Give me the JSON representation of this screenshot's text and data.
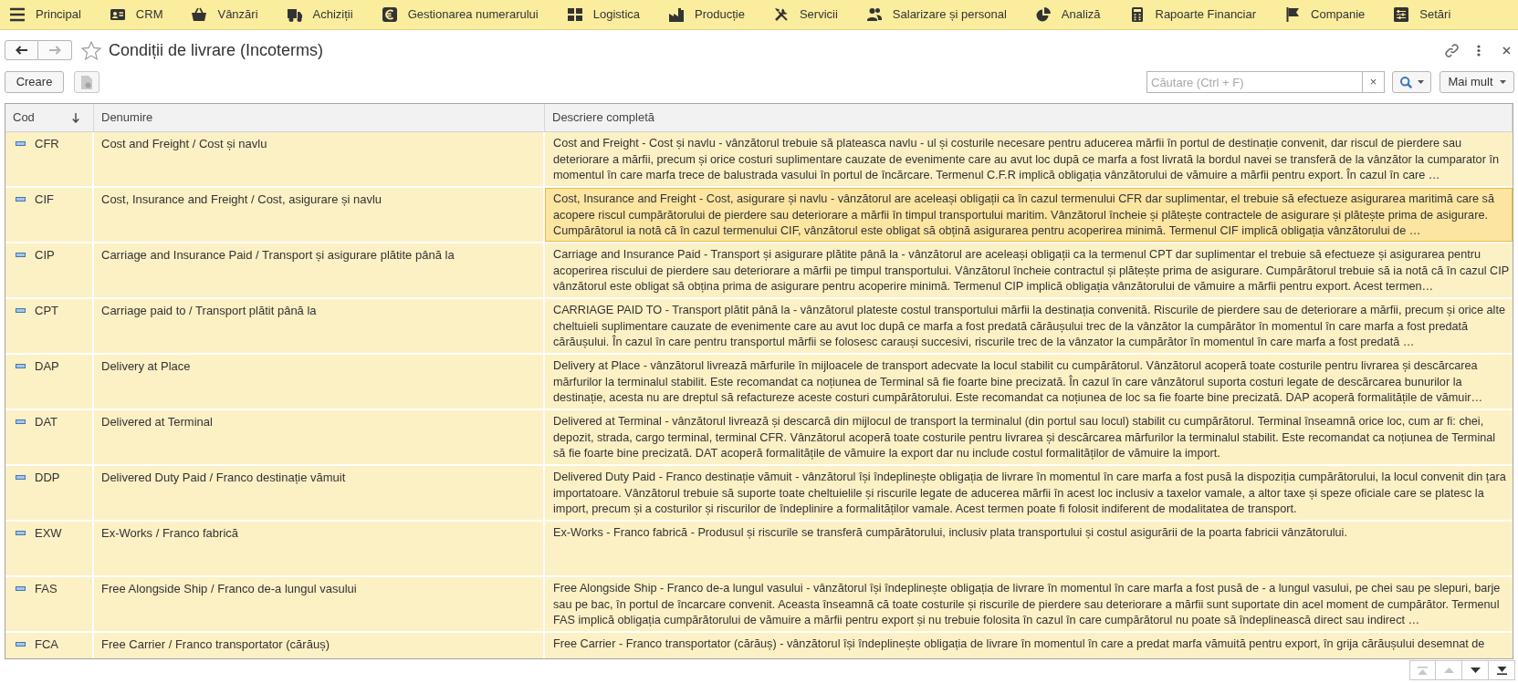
{
  "menu_bar": {
    "items": [
      {
        "label": "Principal"
      },
      {
        "label": "CRM"
      },
      {
        "label": "Vânzări"
      },
      {
        "label": "Achiziții"
      },
      {
        "label": "Gestionarea numerarului"
      },
      {
        "label": "Logistica"
      },
      {
        "label": "Producție"
      },
      {
        "label": "Servicii"
      },
      {
        "label": "Salarizare și personal"
      },
      {
        "label": "Analiză"
      },
      {
        "label": "Rapoarte Financiar"
      },
      {
        "label": "Companie"
      },
      {
        "label": "Setări"
      }
    ]
  },
  "title_bar": {
    "navigation": [
      {
        "kind": "back",
        "disabled": false
      },
      {
        "kind": "forward",
        "disabled": true
      }
    ],
    "favorite": false,
    "title": "Condiții de livrare (Incoterms)"
  },
  "toolbar": {
    "create_button": "Creare",
    "search": {
      "placeholder": "Căutare (Ctrl + F)",
      "clear": "×"
    },
    "more_button": "Mai mult"
  },
  "table": {
    "columns": [
      {
        "label": "Cod",
        "sorted": true
      },
      {
        "label": "Denumire",
        "sorted": false
      },
      {
        "label": "Descriere completă",
        "sorted": false
      }
    ],
    "rows": [
      {
        "code": "CFR",
        "name": "Cost and Freight / Cost și navlu",
        "description": "Cost and Freight - Cost și navlu - vânzătorul trebuie să plateasca navlu - ul și costurile necesare pentru aducerea mărfii în portul de destinație convenit, dar riscul de pierdere sau deteriorare a mărfii, precum și orice costuri suplimentare cauzate de evenimente care au avut loc după ce marfa a fost livrată la bordul navei se transferă de la vânzător la cumparator în momentul în care marfa trece de balustrada vasului în portul de încărcare. Termenul C.F.R implică obligația vânzătorului de vămuire a mărfii pentru export. În cazul în care …",
        "selected": false
      },
      {
        "code": "CIF",
        "name": "Cost, Insurance and Freight / Cost, asigurare și navlu",
        "description": "Cost, Insurance and Freight - Cost, asigurare și navlu - vânzătorul are aceleași obligații ca în cazul termenului CFR dar suplimentar, el trebuie să efectueze asigurarea maritimă care să acopere riscul cumpărătorului de pierdere sau deteriorare a mărfii în timpul transportului maritim. Vânzătorul încheie și plătește contractele de asigurare și plătește prima de asigurare. Cumpărătorul ia notă că în cazul termenului CIF, vânzătorul este obligat să obțină asigurarea pentru acoperirea minimă. Termenul CIF implică obligația vânzătorului de …",
        "selected": true
      },
      {
        "code": "CIP",
        "name": "Carriage and Insurance Paid / Transport și asigurare plătite până la",
        "description": "Carriage and Insurance Paid - Transport și asigurare plătite până la - vânzătorul are aceleași obligații ca la termenul CPT dar suplimentar el trebuie să efectueze și asigurarea pentru acoperirea riscului de pierdere sau deteriorare a mărfii pe timpul transportului. Vânzătorul încheie contractul și plătește prima de asigurare. Cumpărătorul trebuie să ia notă că în cazul CIP vânzătorul este obligat să obțina prima de asigurare pentru acoperire minimă. Termenul CIP implică obligația vânzătorului de vămuire a mărfii pentru export. Acest termen…",
        "selected": false
      },
      {
        "code": "CPT",
        "name": "Carriage paid to / Transport plătit până la",
        "description": "CARRIAGE PAID TO - Transport plătit până la - vânzătorul plateste costul transportului mărfii la destinația convenită. Riscurile de pierdere sau de deteriorare a mărfii, precum și orice alte cheltuieli suplimentare cauzate de evenimente care au avut loc după ce marfa a fost predată cărăușului trec de la vânzător la cumpărător în momentul în care marfa a fost predată cărăușului. În cazul în care pentru transportul mărfii se folosesc carauși succesivi, riscurile trec de la vânzator la cumpărător în momentul în care marfa a fost predată …",
        "selected": false
      },
      {
        "code": "DAP",
        "name": "Delivery at Place",
        "description": "Delivery at Place - vânzătorul livrează mărfurile în mijloacele de transport adecvate la locul stabilit cu cumpărătorul. Vânzătorul acoperă toate costurile pentru livrarea și descărcarea mărfurilor la terminalul stabilit. Este recomandat ca noțiunea de Terminal să fie foarte bine precizată. În cazul în care vânzătorul suporta costuri legate de descărcarea bunurilor la destinație, acesta nu are dreptul să refactureze aceste costuri cumpărătorului. Este recomandat ca noțiunea de loc sa fie foarte bine precizată. DAP acoperă formalitățile de vămuir…",
        "selected": false
      },
      {
        "code": "DAT",
        "name": "Delivered at Terminal",
        "description": "Delivered at Terminal - vânzătorul livrează și descarcă din mijlocul de transport la terminalul (din portul sau locul) stabilit cu cumpărătorul. Terminal înseamnă orice loc, cum ar fi: chei, depozit, strada, cargo terminal, terminal CFR. Vânzătorul acoperă toate costurile pentru livrarea și descărcarea mărfurilor la terminalul stabilit. Este recomandat ca noțiunea de Terminal să fie foarte bine precizată. DAT acoperă formalitățile de vămuire la export dar nu include costul formalităților de vămuire la import.",
        "selected": false
      },
      {
        "code": "DDP",
        "name": "Delivered Duty Paid / Franco destinație vămuit",
        "description": "Delivered Duty Paid - Franco destinație vămuit - vânzătorul își îndeplinește obligația de livrare în momentul în care marfa a fost pusă la dispoziția cumpărătorului, la locul convenit din țara importatoare. Vânzătorul trebuie să suporte toate cheltuielile și riscurile legate de aducerea mărfii în acest loc inclusiv a taxelor vamale, a altor taxe și speze oficiale care se platesc la import, precum și a costurilor și riscurilor de îndeplinire a formalităților vamale. Acest termen poate fi folosit indiferent de modalitatea de transport.",
        "selected": false
      },
      {
        "code": "EXW",
        "name": "Ex-Works / Franco fabrică",
        "description": "Ex-Works - Franco fabrică - Produsul și riscurile se transferă cumpărătorului, inclusiv plata transportului și costul asigurării de la poarta fabricii vânzătorului.",
        "selected": false
      },
      {
        "code": "FAS",
        "name": "Free Alongside Ship / Franco de-a lungul vasului",
        "description": "Free Alongside Ship - Franco de-a lungul vasului - vânzătorul își îndeplinește obligația de livrare în momentul în care marfa a fost pusă de - a lungul vasului, pe chei sau pe slepuri, barje sau pe bac, în portul de încarcare convenit. Aceasta înseamnă că toate costurile și riscurile de pierdere sau deteriorare a mărfii sunt suportate din acel moment de cumpărător. Termenul FAS implică obligația cumpărătorului de vămuire a mărfii pentru export și nu trebuie folosita în cazul în care cumpărătorul nu poate să îndeplinească direct sau indirect …",
        "selected": false
      },
      {
        "code": "FCA",
        "name": "Free Carrier / Franco transportator (cărăuș)",
        "description": "Free Carrier - Franco transportator (cărăuș) - vânzătorul își îndeplinește obligația de livrare în momentul în care a predat marfa vămuită pentru export, în grija cărăușului desemnat de",
        "selected": false
      }
    ]
  },
  "pager": [
    {
      "kind": "first",
      "disabled": true
    },
    {
      "kind": "previous",
      "disabled": true
    },
    {
      "kind": "next",
      "disabled": false
    },
    {
      "kind": "last",
      "disabled": false
    }
  ]
}
